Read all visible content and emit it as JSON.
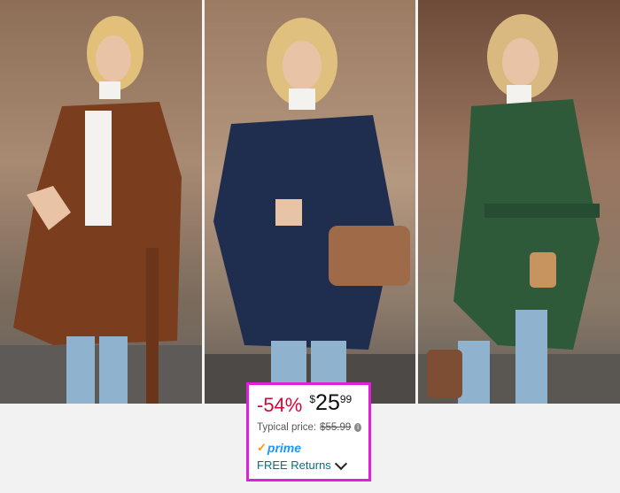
{
  "product": {
    "images": [
      {
        "name": "brown-shirt-jacket-photo",
        "color": "#7a3e1e"
      },
      {
        "name": "navy-shirt-jacket-photo",
        "color": "#1f2d4f"
      },
      {
        "name": "green-shirt-jacket-photo",
        "color": "#2e5a3a"
      }
    ]
  },
  "pricing": {
    "discount": "-54%",
    "currency_symbol": "$",
    "price_whole": "25",
    "price_fraction": "99",
    "typical_label": "Typical price:",
    "typical_price": "$55.99",
    "info_icon": "ⓘ"
  },
  "prime": {
    "label": "prime",
    "check_icon": "✓"
  },
  "returns": {
    "label": "FREE Returns"
  },
  "colors": {
    "discount": "#cc0c39",
    "link": "#007185",
    "prime_blue": "#1a98ff",
    "prime_check": "#ff9900",
    "highlight_border": "#e020d8"
  }
}
